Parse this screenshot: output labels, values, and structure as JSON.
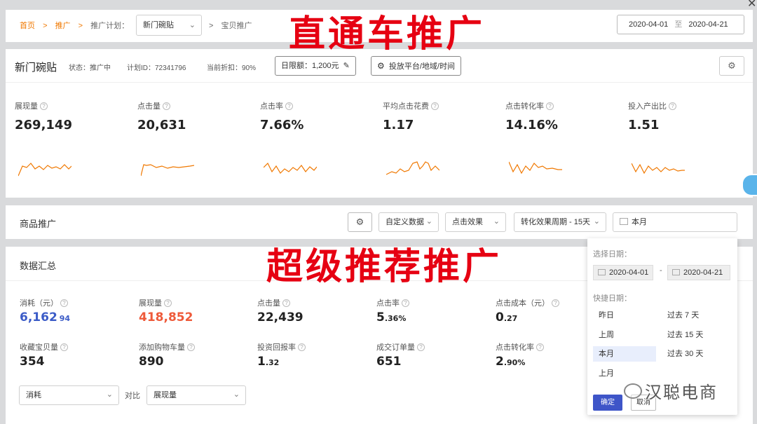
{
  "close_glyph": "✕",
  "breadcrumb": {
    "home": "首页",
    "sep": ">",
    "promo": "推广",
    "plan_label": "推广计划：",
    "plan_value": "新门碗贴",
    "last": "宝贝推广"
  },
  "date_range": {
    "start": "2020-04-01",
    "to": "至",
    "end": "2020-04-21"
  },
  "overlay": {
    "title_top": "直通车推广",
    "title_mid": "超级推荐推广",
    "watermark": "汉聪电商"
  },
  "plan": {
    "name": "新门碗贴",
    "status": "状态：推广中",
    "plan_id": "计划ID：72341796",
    "discount": "当前折扣：90%",
    "budget_button": "日限额：1,200元",
    "platform_button": "投放平台/地域/时间"
  },
  "metrics": [
    {
      "label": "展现量",
      "value": "269,149"
    },
    {
      "label": "点击量",
      "value": "20,631"
    },
    {
      "label": "点击率",
      "value": "7.66%"
    },
    {
      "label": "平均点击花费",
      "value": "1.17"
    },
    {
      "label": "点击转化率",
      "value": "14.16%"
    },
    {
      "label": "投入产出比",
      "value": "1.51"
    }
  ],
  "sparkline_color": "#f07800",
  "product_section": {
    "title": "商品推广",
    "filters": {
      "custom_data": "自定义数据",
      "click_effect": "点击效果",
      "conversion_cycle": "转化效果周期 - 15天",
      "period": "本月"
    }
  },
  "summary": {
    "title": "数据汇总",
    "row1": [
      {
        "label": "消耗（元）",
        "int": "6,162",
        "dec": "94",
        "color": "#3b5bc7"
      },
      {
        "label": "展现量",
        "int": "418,852",
        "dec": "",
        "color": "#ee5a3a"
      },
      {
        "label": "点击量",
        "int": "22,439",
        "dec": "",
        "color": "#222222"
      },
      {
        "label": "点击率",
        "int": "5",
        "dec": ".36%",
        "color": "#222222"
      },
      {
        "label": "点击成本（元）",
        "int": "0",
        "dec": ".27",
        "color": "#222222"
      }
    ],
    "row2": [
      {
        "label": "收藏宝贝量",
        "int": "354",
        "dec": ""
      },
      {
        "label": "添加购物车量",
        "int": "890",
        "dec": ""
      },
      {
        "label": "投资回报率",
        "int": "1",
        "dec": ".32"
      },
      {
        "label": "成交订单量",
        "int": "651",
        "dec": ""
      },
      {
        "label": "点击转化率",
        "int": "2",
        "dec": ".90%"
      }
    ],
    "compare": {
      "left": "消耗",
      "vs": "对比",
      "right": "展现量"
    }
  },
  "date_popup": {
    "choose_label": "选择日期：",
    "from": "2020-04-01",
    "dash": "-",
    "to": "2020-04-21",
    "quick_label": "快捷日期：",
    "quick_left": [
      "昨日",
      "上周",
      "本月",
      "上月"
    ],
    "quick_right": [
      "过去 7 天",
      "过去 15 天",
      "过去 30 天"
    ],
    "confirm": "确定",
    "cancel": "取消"
  }
}
